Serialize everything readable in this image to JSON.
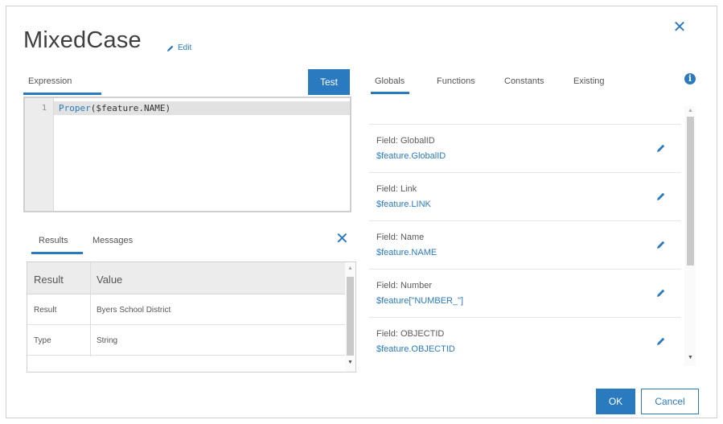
{
  "dialog": {
    "title": "MixedCase",
    "edit_label": "Edit"
  },
  "editor": {
    "tab_label": "Expression",
    "test_label": "Test",
    "line_number": "1",
    "code_fn": "Proper",
    "code_rest": "($feature.NAME)"
  },
  "results": {
    "tabs": [
      "Results",
      "Messages"
    ],
    "headers": [
      "Result",
      "Value"
    ],
    "rows": [
      {
        "key": "Result",
        "value": "Byers School District"
      },
      {
        "key": "Type",
        "value": "String"
      }
    ]
  },
  "right_panel": {
    "tabs": [
      "Globals",
      "Functions",
      "Constants",
      "Existing"
    ],
    "fields": [
      {
        "label": "Field: GlobalID",
        "value": "$feature.GlobalID"
      },
      {
        "label": "Field: Link",
        "value": "$feature.LINK"
      },
      {
        "label": "Field: Name",
        "value": "$feature.NAME"
      },
      {
        "label": "Field: Number",
        "value": "$feature[\"NUMBER_\"]"
      },
      {
        "label": "Field: OBJECTID",
        "value": "$feature.OBJECTID"
      }
    ]
  },
  "footer": {
    "ok_label": "OK",
    "cancel_label": "Cancel"
  },
  "colors": {
    "accent": "#2a7ac0"
  },
  "icons": {
    "close": "close-icon",
    "edit": "pencil-icon",
    "info": "info-icon"
  }
}
